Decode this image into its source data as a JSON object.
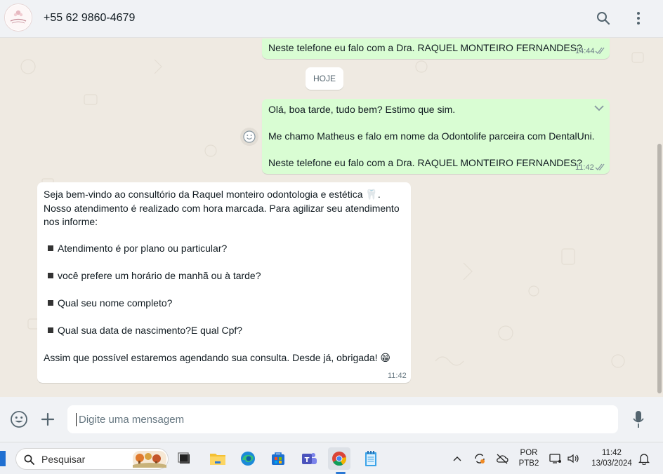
{
  "header": {
    "avatar_text": "Raquel Monteiro",
    "contact": "+55 62 9860-4679",
    "icons": [
      "search-icon",
      "menu-icon"
    ]
  },
  "chat": {
    "messages": [
      {
        "direction": "out",
        "text": "Neste telefone eu falo com a Dra. RAQUEL MONTEIRO FERNANDES?",
        "time": "14:44",
        "status": "sent"
      },
      {
        "type": "date",
        "label": "HOJE"
      },
      {
        "direction": "out",
        "lines": [
          "Olá, boa tarde, tudo bem? Estimo que sim.",
          "Me chamo Matheus e falo em nome da Odontolife parceira com DentalUni.",
          "Neste telefone eu falo com a Dra. RAQUEL MONTEIRO FERNANDES?"
        ],
        "time": "11:42",
        "status": "sent"
      },
      {
        "direction": "in",
        "lines": [
          "Seja bem-vindo ao consultório da Raquel monteiro odontologia e estética 🦷.",
          "Nosso atendimento é realizado com hora marcada. Para agilizar seu atendimento",
          "nos informe:",
          "Atendimento é por plano ou particular?",
          "você prefere um horário de manhã ou à tarde?",
          "Qual seu nome completo?",
          "Qual sua  data de nascimento?E qual Cpf?",
          "Assim que possível estaremos agendando sua consulta. Desde já, obrigada! 😁"
        ],
        "time": "11:42"
      }
    ]
  },
  "composer": {
    "placeholder": "Digite uma mensagem",
    "icons": [
      "emoji-icon",
      "plus-icon",
      "mic-icon"
    ]
  },
  "taskbar": {
    "search_label": "Pesquisar",
    "language": "POR",
    "layout": "PTB2",
    "clock_time": "11:42",
    "clock_date": "13/03/2024"
  },
  "colors": {
    "outgoing_bubble": "#d9fdd3",
    "incoming_bubble": "#ffffff",
    "chat_background": "#efeae2",
    "header_background": "#f0f2f5"
  }
}
